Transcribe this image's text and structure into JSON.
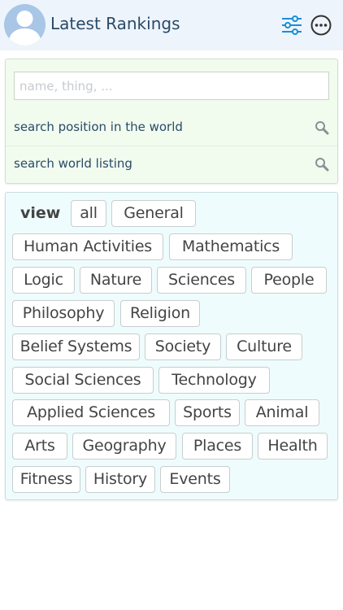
{
  "header": {
    "title": "Latest Rankings",
    "accent": "#1a8fd6"
  },
  "search": {
    "placeholder": "name, thing, ...",
    "rows": [
      {
        "label": "search position in the world",
        "icon": "search-icon"
      },
      {
        "label": "search world listing",
        "icon": "search-icon"
      }
    ]
  },
  "tags": {
    "view_label": "view",
    "items": [
      "all",
      "General",
      "Human Activities",
      "Mathematics",
      "Logic",
      "Nature",
      "Sciences",
      "People",
      "Philosophy",
      "Religion",
      "Belief Systems",
      "Society",
      "Culture",
      "Social Sciences",
      "Technology",
      "Applied Sciences",
      "Sports",
      "Animal",
      "Arts",
      "Geography",
      "Places",
      "Health",
      "Fitness",
      "History",
      "Events"
    ]
  }
}
